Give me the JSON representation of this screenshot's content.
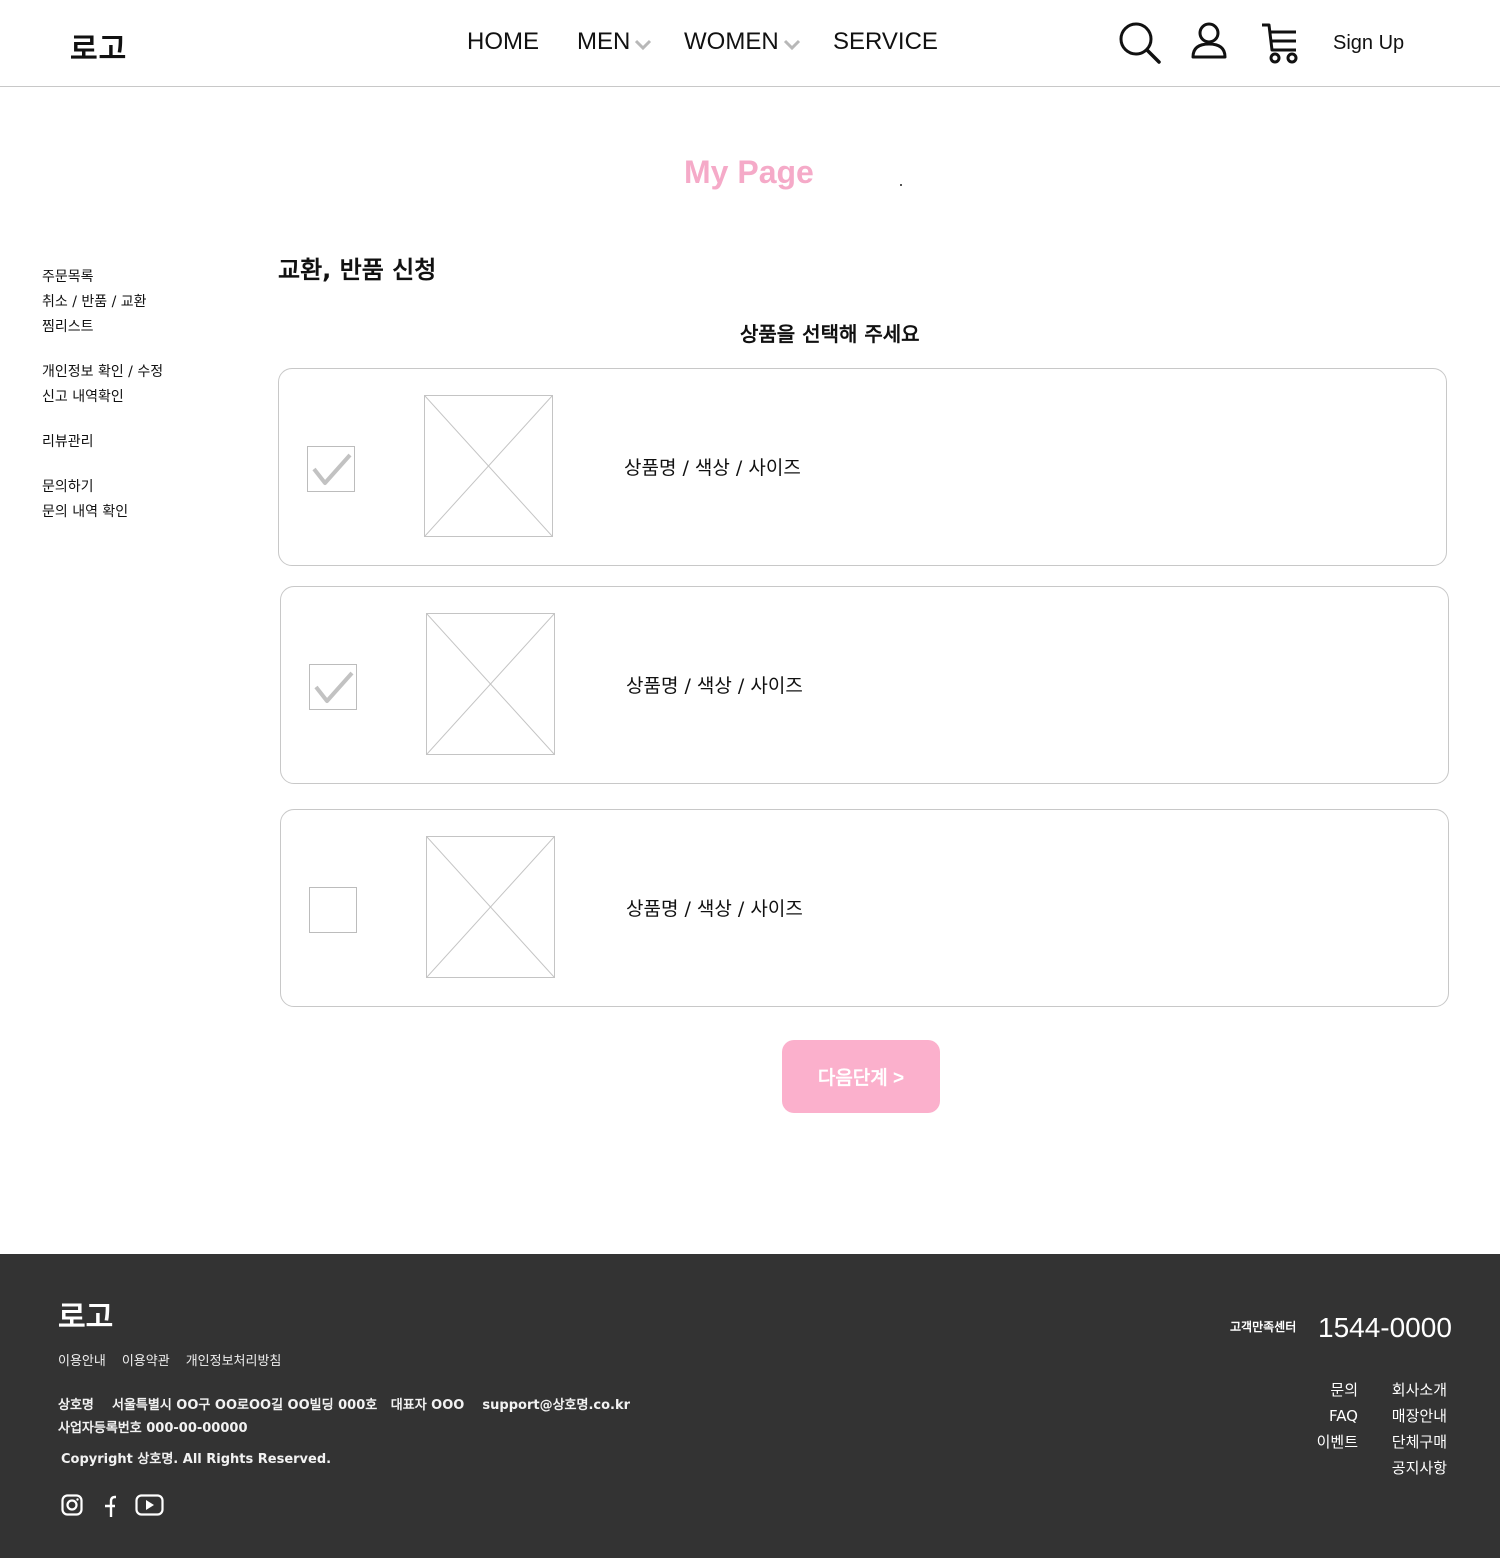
{
  "header": {
    "logo": "로고",
    "nav": [
      {
        "label": "HOME",
        "has_dropdown": false
      },
      {
        "label": "MEN",
        "has_dropdown": true
      },
      {
        "label": "WOMEN",
        "has_dropdown": true
      },
      {
        "label": "SERVICE",
        "has_dropdown": false
      }
    ],
    "icons": [
      "search-icon",
      "user-icon",
      "cart-icon"
    ],
    "signup_label": "Sign Up"
  },
  "page_title": "My Page",
  "sidebar": {
    "groups": [
      [
        "주문목록",
        "취소 / 반품 / 교환",
        "찜리스트"
      ],
      [
        "개인정보 확인 / 수정",
        "신고 내역확인"
      ],
      [
        "리뷰관리"
      ],
      [
        "문의하기",
        "문의 내역 확인"
      ]
    ]
  },
  "main": {
    "section_title": "교환, 반품 신청",
    "subtitle": "상품을 선택해 주세요",
    "products": [
      {
        "label": "상품명 / 색상 / 사이즈",
        "checked": true
      },
      {
        "label": "상품명 / 색상 / 사이즈",
        "checked": true
      },
      {
        "label": "상품명 / 색상 / 사이즈",
        "checked": false
      }
    ],
    "next_button": "다음단계 >"
  },
  "footer": {
    "logo": "로고",
    "links": [
      "이용안내",
      "이용약관",
      "개인정보처리방침"
    ],
    "info_line1": "상호명    서울특별시 OO구 OO로OO길 OO빌딩 000호   대표자 OOO    support@상호명.co.kr",
    "info_line2": "사업자등록번호 000-00-00000",
    "copyright": "Copyright 상호명. All Rights Reserved.",
    "social_icons": [
      "instagram-icon",
      "facebook-icon",
      "youtube-icon"
    ],
    "cs_label": "고객만족센터",
    "cs_number": "1544-0000",
    "col_left": [
      "문의",
      "FAQ",
      "이벤트"
    ],
    "col_right": [
      "회사소개",
      "매장안내",
      "단체구매",
      "공지사항"
    ]
  },
  "colors": {
    "accent_pink": "#f5aac8",
    "button_pink": "#fbb0cc",
    "footer_bg": "#333333"
  }
}
